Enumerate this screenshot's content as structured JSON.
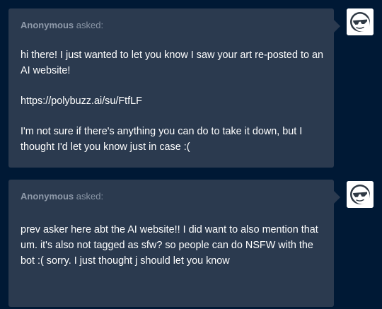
{
  "asks": [
    {
      "asker": "Anonymous",
      "asked_label": "asked:",
      "paragraphs": [
        "hi there! I just wanted to let you know I saw your art re-posted to an AI website!",
        "https://polybuzz.ai/su/FtfLF",
        "I'm not sure if there's anything you can do to take it down, but I thought I'd let you know just in case :("
      ],
      "avatar_icon": "anonymous-sunglasses-face-icon"
    },
    {
      "asker": "Anonymous",
      "asked_label": "asked:",
      "paragraphs": [
        "prev asker here abt the AI website!! I did want to also mention  that um. it's also not tagged as sfw? so people can do NSFW with the bot :( sorry. I just thought j should let you know"
      ],
      "avatar_icon": "anonymous-sunglasses-face-icon"
    }
  ],
  "colors": {
    "page_background": "#001935",
    "bubble_background": "#2b3a4f",
    "body_text": "#ffffff",
    "meta_text": "#8a96a6"
  }
}
